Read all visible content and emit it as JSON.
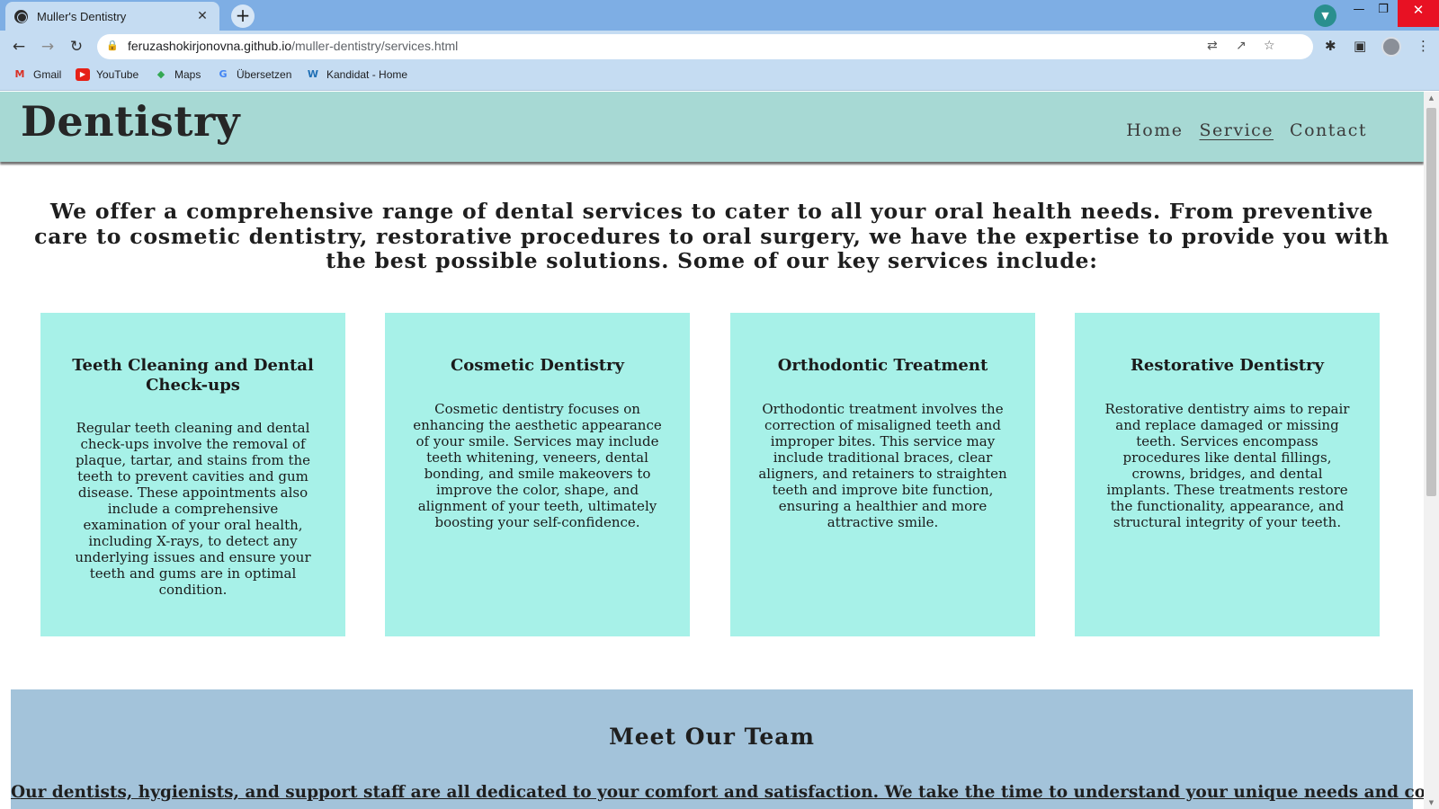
{
  "browser": {
    "tab_title": "Muller's Dentistry",
    "url_host": "feruzashokirjonovna.github.io",
    "url_path": "/muller-dentistry/services.html",
    "bookmarks": [
      "Gmail",
      "YouTube",
      "Maps",
      "Übersetzen",
      "Kandidat - Home"
    ]
  },
  "site": {
    "logo": "Dentistry",
    "nav": [
      "Home",
      "Service",
      "Contact"
    ],
    "active_nav": "Service"
  },
  "intro": "We offer a comprehensive range of dental services to cater to all your oral health needs. From preventive care to cosmetic dentistry, restorative procedures to oral surgery, we have the expertise to provide you with the best possible solutions. Some of our key services include:",
  "services": [
    {
      "title": "Teeth Cleaning and Dental Check-ups",
      "text": "Regular teeth cleaning and dental check-ups involve the removal of plaque, tartar, and stains from the teeth to prevent cavities and gum disease. These appointments also include a comprehensive examination of your oral health, including X-rays, to detect any underlying issues and ensure your teeth and gums are in optimal condition."
    },
    {
      "title": "Cosmetic Dentistry",
      "text": "Cosmetic dentistry focuses on enhancing the aesthetic appearance of your smile. Services may include teeth whitening, veneers, dental bonding, and smile makeovers to improve the color, shape, and alignment of your teeth, ultimately boosting your self-confidence."
    },
    {
      "title": "Orthodontic Treatment",
      "text": "Orthodontic treatment involves the correction of misaligned teeth and improper bites. This service may include traditional braces, clear aligners, and retainers to straighten teeth and improve bite function, ensuring a healthier and more attractive smile."
    },
    {
      "title": "Restorative Dentistry",
      "text": "Restorative dentistry aims to repair and replace damaged or missing teeth. Services encompass procedures like dental fillings, crowns, bridges, and dental implants. These treatments restore the functionality, appearance, and structural integrity of your teeth."
    }
  ],
  "team": {
    "heading": "Meet Our Team",
    "text": "Our dentists, hygienists, and support staff are all dedicated to your comfort and satisfaction. We take the time to understand your unique needs and concerns."
  },
  "colors": {
    "header_bg": "#a7d9d4",
    "card_bg": "#a7f1e8",
    "team_bg": "#a3c3da",
    "tab_strip": "#7eaee4"
  }
}
